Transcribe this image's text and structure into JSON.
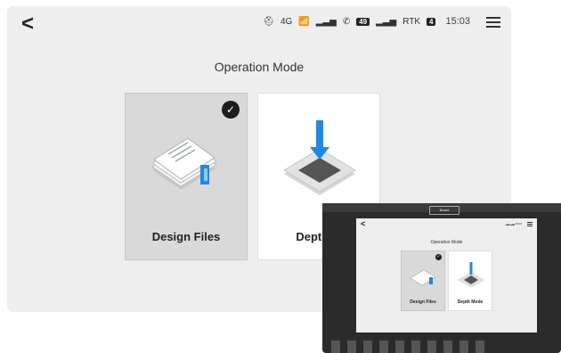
{
  "header": {
    "back_icon": "<",
    "time": "15:03",
    "badge1": "49",
    "rtk_label": "RTK",
    "badge2": "4",
    "net": "4G"
  },
  "page": {
    "title": "Operation Mode"
  },
  "cards": [
    {
      "label": "Design Files",
      "selected": true
    },
    {
      "label": "Depth M",
      "selected": false
    }
  ],
  "device": {
    "brand": "Brand",
    "mini_title": "Operation Mode",
    "mini_cards": [
      "Design Files",
      "Depth Mode"
    ]
  }
}
